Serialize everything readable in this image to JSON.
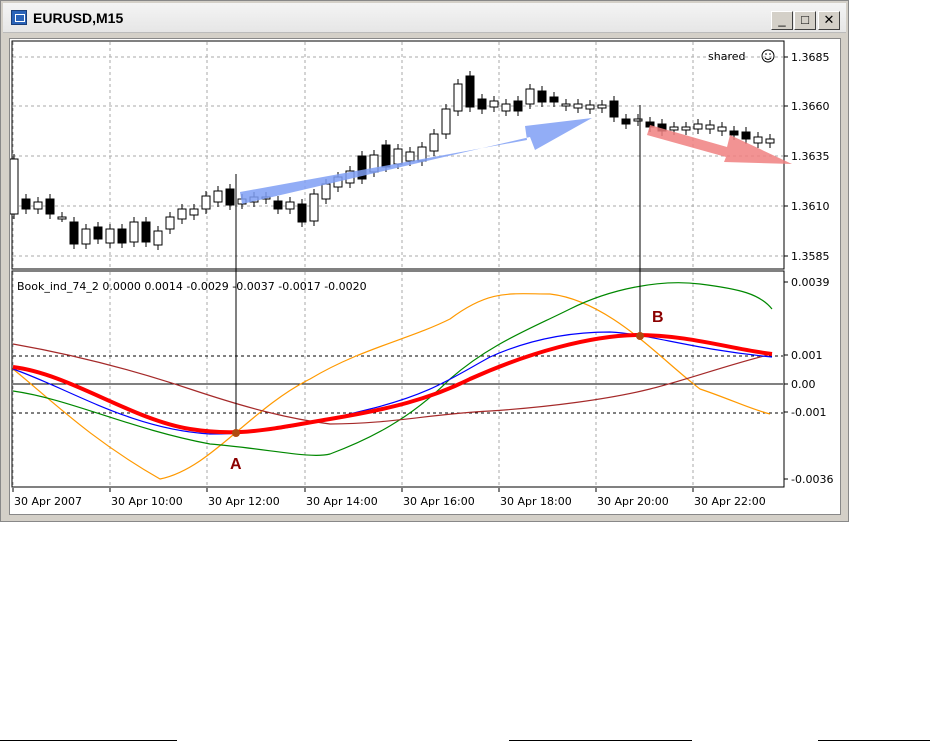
{
  "window": {
    "title": "EURUSD,M15",
    "buttons": [
      "_",
      "□",
      "✕"
    ]
  },
  "chart": {
    "shared_label": "shared",
    "price_ticks": [
      "1.3685",
      "1.3660",
      "1.3635",
      "1.3610",
      "1.3585"
    ],
    "indicator_caption": "Book_ind_74_2 0.0000 0.0014 -0.0029 -0.0037 -0.0017 -0.0020",
    "indicator_ticks": [
      "0.0039",
      "0.001",
      "0.00",
      "-0.001",
      "-0.0036"
    ],
    "time_ticks": [
      "30 Apr 2007",
      "30 Apr 10:00",
      "30 Apr 12:00",
      "30 Apr 14:00",
      "30 Apr 16:00",
      "30 Apr 18:00",
      "30 Apr 20:00",
      "30 Apr 22:00"
    ],
    "point_a": "A",
    "point_b": "B",
    "colors": {
      "main_line": "#ff0000",
      "blue_line": "#0000ff",
      "orange_line": "#ff9900",
      "green_line": "#008800",
      "brown_line": "#a52a2a",
      "up_arrow": "#7f9ff5",
      "down_arrow": "#f08080",
      "marker": "#b04a10"
    }
  }
}
